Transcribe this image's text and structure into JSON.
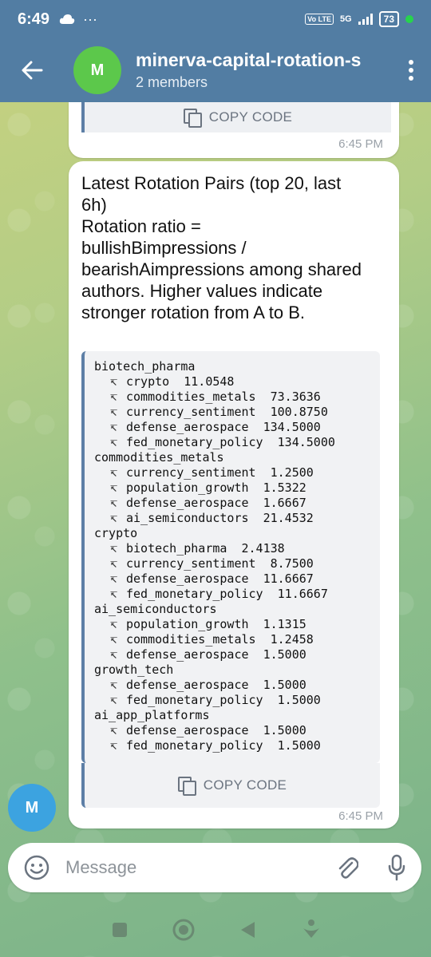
{
  "status_bar": {
    "time": "6:49",
    "network": "5G",
    "volte": "Vo LTE",
    "battery": "73"
  },
  "header": {
    "avatar_letter": "M",
    "title": "minerva-capital-rotation-s",
    "subtitle": "2 members"
  },
  "messages": {
    "top": {
      "copy_label": "COPY CODE",
      "time": "6:45 PM"
    },
    "main": {
      "text_lines": [
        "Latest Rotation Pairs (top 20, last",
        "6h)",
        "Rotation ratio =",
        "bullishBimpressions /",
        "bearishAimpressions among shared",
        "authors. Higher values indicate",
        "stronger rotation from A to B."
      ],
      "code": [
        {
          "type": "group",
          "text": "biotech_pharma"
        },
        {
          "type": "item",
          "text": "crypto  11.0548"
        },
        {
          "type": "item",
          "text": "commodities_metals  73.3636"
        },
        {
          "type": "item",
          "text": "currency_sentiment  100.8750"
        },
        {
          "type": "item",
          "text": "defense_aerospace  134.5000"
        },
        {
          "type": "item",
          "text": "fed_monetary_policy  134.5000"
        },
        {
          "type": "group",
          "text": "commodities_metals"
        },
        {
          "type": "item",
          "text": "currency_sentiment  1.2500"
        },
        {
          "type": "item",
          "text": "population_growth  1.5322"
        },
        {
          "type": "item",
          "text": "defense_aerospace  1.6667"
        },
        {
          "type": "item",
          "text": "ai_semiconductors  21.4532"
        },
        {
          "type": "group",
          "text": "crypto"
        },
        {
          "type": "item",
          "text": "biotech_pharma  2.4138"
        },
        {
          "type": "item",
          "text": "currency_sentiment  8.7500"
        },
        {
          "type": "item",
          "text": "defense_aerospace  11.6667"
        },
        {
          "type": "item",
          "text": "fed_monetary_policy  11.6667"
        },
        {
          "type": "group",
          "text": "ai_semiconductors"
        },
        {
          "type": "item",
          "text": "population_growth  1.1315"
        },
        {
          "type": "item",
          "text": "commodities_metals  1.2458"
        },
        {
          "type": "item",
          "text": "defense_aerospace  1.5000"
        },
        {
          "type": "group",
          "text": "growth_tech"
        },
        {
          "type": "item",
          "text": "defense_aerospace  1.5000"
        },
        {
          "type": "item",
          "text": "fed_monetary_policy  1.5000"
        },
        {
          "type": "group",
          "text": "ai_app_platforms"
        },
        {
          "type": "item",
          "text": "defense_aerospace  1.5000"
        },
        {
          "type": "item",
          "text": "fed_monetary_policy  1.5000"
        }
      ],
      "arrow_glyph": "↸",
      "copy_label": "COPY CODE",
      "time": "6:45 PM",
      "sender_letter": "M"
    }
  },
  "input": {
    "placeholder": "Message"
  },
  "colors": {
    "header": "#527da3",
    "accent": "#5d7fa6",
    "avatar_group": "#5cc84b",
    "avatar_sender": "#3ca3e0"
  }
}
